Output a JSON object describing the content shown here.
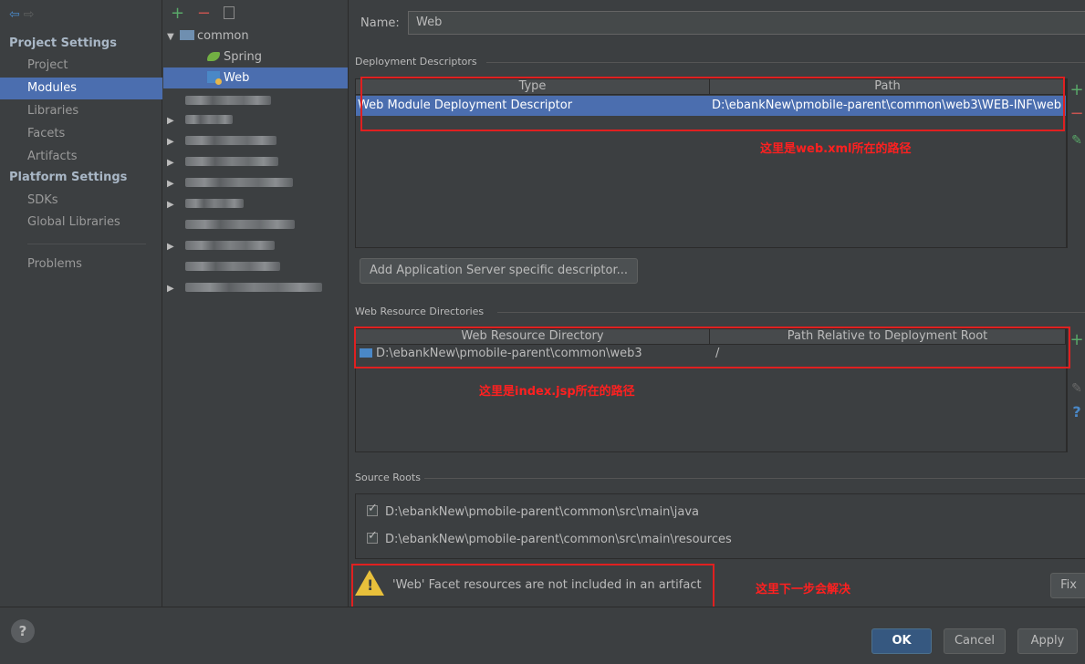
{
  "sidebar": {
    "sections": [
      {
        "title": "Project Settings",
        "items": [
          "Project",
          "Modules",
          "Libraries",
          "Facets",
          "Artifacts"
        ]
      },
      {
        "title": "Platform Settings",
        "items": [
          "SDKs",
          "Global Libraries"
        ]
      }
    ],
    "problems": "Problems",
    "active": "Modules"
  },
  "tree": {
    "toolbar": {
      "add": "+",
      "remove": "−"
    },
    "root": "common",
    "children": [
      "Spring",
      "Web"
    ],
    "selected": "Web"
  },
  "main": {
    "name_label": "Name:",
    "name_value": "Web",
    "deployment": {
      "title": "Deployment Descriptors",
      "columns": [
        "Type",
        "Path"
      ],
      "rows": [
        {
          "type": "Web Module Deployment Descriptor",
          "path": "D:\\ebankNew\\pmobile-parent\\common\\web3\\WEB-INF\\web"
        }
      ],
      "annotation": "这里是web.xml所在的路径",
      "add_server_button": "Add Application Server specific descriptor..."
    },
    "web_resources": {
      "title": "Web Resource Directories",
      "columns": [
        "Web Resource Directory",
        "Path Relative to Deployment Root"
      ],
      "rows": [
        {
          "directory": "D:\\ebankNew\\pmobile-parent\\common\\web3",
          "relative": "/"
        }
      ],
      "annotation": "这里是index.jsp所在的路径"
    },
    "source_roots": {
      "title": "Source Roots",
      "items": [
        "D:\\ebankNew\\pmobile-parent\\common\\src\\main\\java",
        "D:\\ebankNew\\pmobile-parent\\common\\src\\main\\resources"
      ]
    },
    "warning": {
      "text": "'Web' Facet resources are not included in an artifact",
      "annotation": "这里下一步会解决",
      "fix_button": "Fix"
    }
  },
  "footer": {
    "help": "?",
    "ok": "OK",
    "cancel": "Cancel",
    "apply": "Apply"
  },
  "colors": {
    "background": "#3c3f41",
    "selection": "#4b6eaf",
    "annotation_red": "#e02020",
    "add_green": "#59a869",
    "remove_red": "#c75450"
  }
}
